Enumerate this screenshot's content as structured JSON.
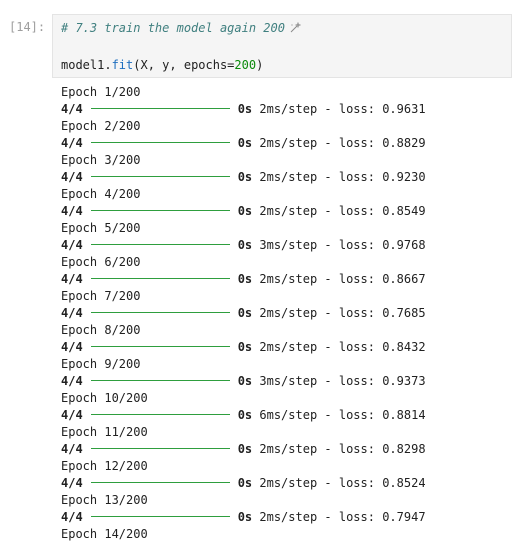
{
  "cell": {
    "prompt": "[14]:",
    "code": {
      "comment": "# 7.3 train the model again 200",
      "sparkle_icon": "sparkle-icon",
      "line2_obj": "model1.",
      "line2_fn": "fit",
      "line2_args": "(X, y, epochs=",
      "line2_num": "200",
      "line2_close": ")"
    }
  },
  "output": {
    "epochs": [
      {
        "epoch": "Epoch 1/200",
        "steps": "4/4",
        "time": "0s",
        "rate": "2ms/step",
        "loss": "- loss: 0.9631"
      },
      {
        "epoch": "Epoch 2/200",
        "steps": "4/4",
        "time": "0s",
        "rate": "2ms/step",
        "loss": "- loss: 0.8829"
      },
      {
        "epoch": "Epoch 3/200",
        "steps": "4/4",
        "time": "0s",
        "rate": "2ms/step",
        "loss": "- loss: 0.9230"
      },
      {
        "epoch": "Epoch 4/200",
        "steps": "4/4",
        "time": "0s",
        "rate": "2ms/step",
        "loss": "- loss: 0.8549"
      },
      {
        "epoch": "Epoch 5/200",
        "steps": "4/4",
        "time": "0s",
        "rate": "3ms/step",
        "loss": "- loss: 0.9768"
      },
      {
        "epoch": "Epoch 6/200",
        "steps": "4/4",
        "time": "0s",
        "rate": "2ms/step",
        "loss": "- loss: 0.8667"
      },
      {
        "epoch": "Epoch 7/200",
        "steps": "4/4",
        "time": "0s",
        "rate": "2ms/step",
        "loss": "- loss: 0.7685"
      },
      {
        "epoch": "Epoch 8/200",
        "steps": "4/4",
        "time": "0s",
        "rate": "2ms/step",
        "loss": "- loss: 0.8432"
      },
      {
        "epoch": "Epoch 9/200",
        "steps": "4/4",
        "time": "0s",
        "rate": "3ms/step",
        "loss": "- loss: 0.9373"
      },
      {
        "epoch": "Epoch 10/200",
        "steps": "4/4",
        "time": "0s",
        "rate": "6ms/step",
        "loss": "- loss: 0.8814"
      },
      {
        "epoch": "Epoch 11/200",
        "steps": "4/4",
        "time": "0s",
        "rate": "2ms/step",
        "loss": "- loss: 0.8298"
      },
      {
        "epoch": "Epoch 12/200",
        "steps": "4/4",
        "time": "0s",
        "rate": "2ms/step",
        "loss": "- loss: 0.8524"
      },
      {
        "epoch": "Epoch 13/200",
        "steps": "4/4",
        "time": "0s",
        "rate": "2ms/step",
        "loss": "- loss: 0.7947"
      }
    ],
    "last_epoch": "Epoch 14/200"
  }
}
